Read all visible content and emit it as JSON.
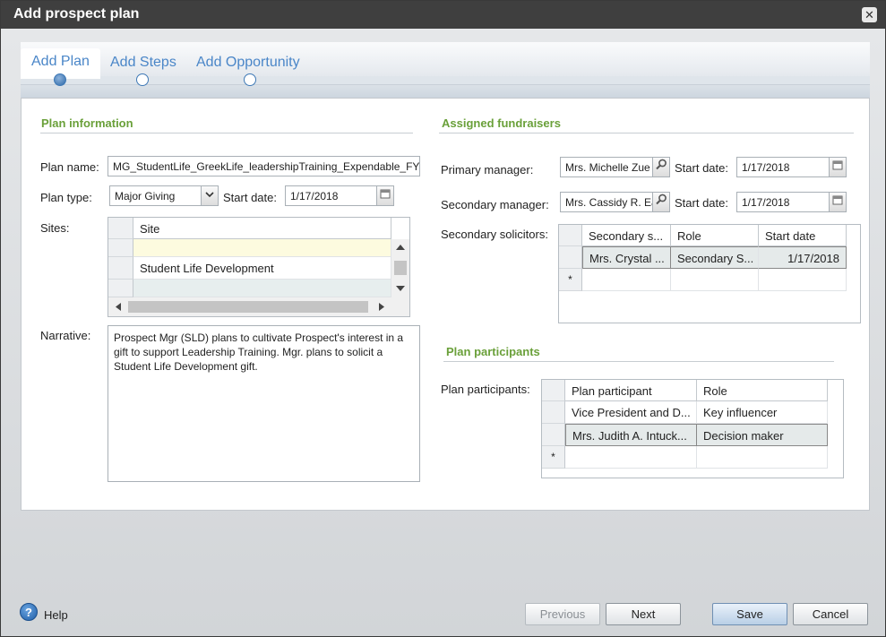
{
  "window": {
    "title": "Add prospect plan",
    "close_glyph": "✕"
  },
  "wizard": {
    "steps": [
      {
        "label": "Add Plan"
      },
      {
        "label": "Add Steps"
      },
      {
        "label": "Add Opportunity"
      }
    ]
  },
  "plan_info": {
    "section_title": "Plan information",
    "plan_name_label": "Plan name:",
    "plan_name_value": "MG_StudentLife_GreekLife_leadershipTraining_Expendable_FY:",
    "plan_type_label": "Plan type:",
    "plan_type_value": "Major Giving",
    "start_date_label": "Start date:",
    "start_date_value": "1/17/2018",
    "sites_label": "Sites:",
    "sites_grid": {
      "header": "Site",
      "rows": [
        "",
        "Student Life Development",
        ""
      ]
    },
    "narrative_label": "Narrative:",
    "narrative_value": "Prospect Mgr (SLD) plans to cultivate Prospect's interest in a gift to support Leadership Training. Mgr. plans to solicit a Student Life Development gift."
  },
  "fundraisers": {
    "section_title": "Assigned fundraisers",
    "primary_label": "Primary manager:",
    "primary_value": "Mrs. Michelle Zue",
    "primary_start_label": "Start date:",
    "primary_start_value": "1/17/2018",
    "secondary_label": "Secondary manager:",
    "secondary_value": "Mrs. Cassidy R. Ea",
    "secondary_start_label": "Start date:",
    "secondary_start_value": "1/17/2018",
    "solicitors_label": "Secondary solicitors:",
    "solicitors_grid": {
      "headers": [
        "Secondary s...",
        "Role",
        "Start date"
      ],
      "rows": [
        [
          "Mrs. Crystal ...",
          "Secondary S...",
          "1/17/2018"
        ]
      ],
      "new_row_marker": "*"
    }
  },
  "participants": {
    "section_title": "Plan participants",
    "label": "Plan participants:",
    "grid": {
      "headers": [
        "Plan participant",
        "Role"
      ],
      "rows": [
        [
          "Vice President and D...",
          "Key influencer"
        ],
        [
          "Mrs. Judith A. Intuck...",
          "Decision maker"
        ]
      ],
      "new_row_marker": "*"
    }
  },
  "footer": {
    "help": "Help",
    "previous": "Previous",
    "next": "Next",
    "save": "Save",
    "cancel": "Cancel"
  },
  "icons": {
    "search": "search-icon",
    "calendar": "calendar-icon",
    "dropdown": "chevron-down-icon",
    "help": "help-icon"
  }
}
